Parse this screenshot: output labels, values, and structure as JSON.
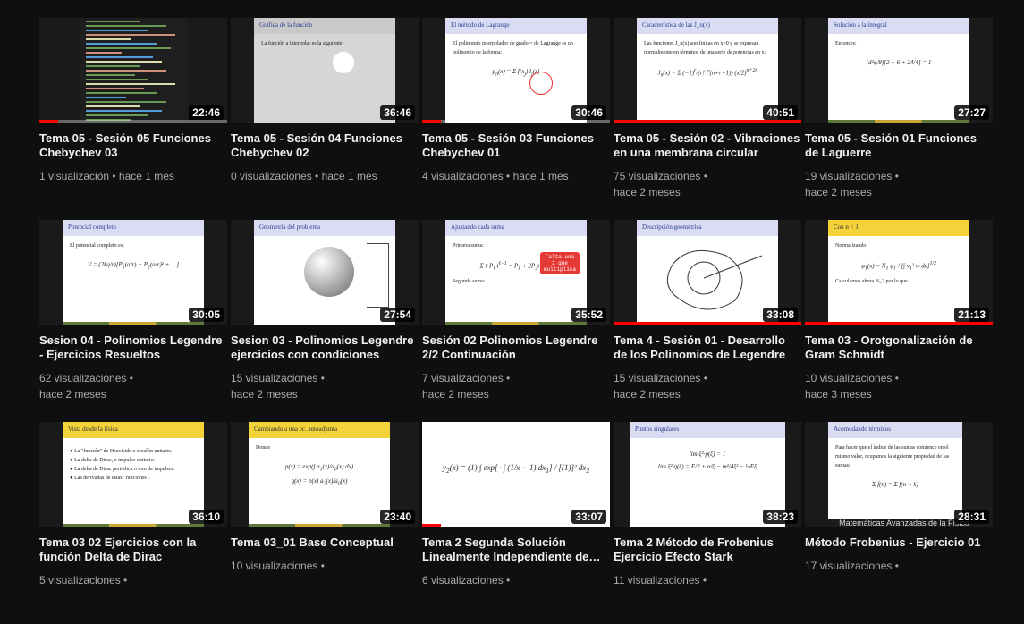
{
  "videos": [
    {
      "title": "Tema 05 - Sesión 05 Funciones Chebychev 03",
      "views": "1 visualización",
      "age": "hace 1 mes",
      "duration": "22:46",
      "progress": 0.1
    },
    {
      "title": "Tema 05 - Sesión 04 Funciones Chebychev 02",
      "views": "0 visualizaciones",
      "age": "hace 1 mes",
      "duration": "36:46",
      "progress": 0.0,
      "slide_header": "Gráfica de la función",
      "slide_text": "La función a interpolar es la siguiente:"
    },
    {
      "title": "Tema 05 - Sesión 03 Funciones Chebychev 01",
      "views": "4 visualizaciones",
      "age": "hace 1 mes",
      "duration": "30:46",
      "progress": 0.1,
      "slide_header": "El método de Lagrange",
      "slide_text": "El polinomio interpolador de grado = de Lagrange es un polinomio de la forma:"
    },
    {
      "title": "Tema 05 - Sesión 02 - Vibraciones en una membrana circular",
      "views": "75 visualizaciones",
      "age": "hace 2 meses",
      "duration": "40:51",
      "progress": 1.0,
      "slide_header": "Característica de las J_n(x)",
      "slide_text": "Las funciones J_n(x) son finitas en x=0 y se expresan normalmente en términos de una serie de potencias en x:"
    },
    {
      "title": "Tema 05 - Sesión 01 Funciones de Laguerre",
      "views": "19 visualizaciones",
      "age": "hace 2 meses",
      "duration": "27:27",
      "progress": 0.0,
      "slide_header": "Solución a la integral",
      "slide_text": "Entonces:"
    },
    {
      "title": "Sesion 04 - Polinomios Legendre - Ejercicios Resueltos",
      "views": "62 visualizaciones",
      "age": "hace 2 meses",
      "duration": "30:05",
      "progress": 0.0,
      "slide_header": "Potencial completo",
      "slide_text": "El potencial completo es:"
    },
    {
      "title": "Sesion 03 - Polinomios Legendre ejercicios con condiciones",
      "views": "15 visualizaciones",
      "age": "hace 2 meses",
      "duration": "27:54",
      "progress": 0.0,
      "slide_header": "Geometría del problema"
    },
    {
      "title": "Sesión 02 Polinomios Legendre 2/2 Continuación",
      "views": "7 visualizaciones",
      "age": "hace 2 meses",
      "duration": "35:52",
      "progress": 0.0,
      "slide_header": "Ajustando cada suma",
      "slide_text": "Primera suma:",
      "slide_text2": "Segunda suma:",
      "balloon": "Falta una 1 que multiplica"
    },
    {
      "title": "Tema 4 - Sesión 01 - Desarrollo de los Polinomios de Legendre",
      "views": "15 visualizaciones",
      "age": "hace 2 meses",
      "duration": "33:08",
      "progress": 1.0,
      "slide_header": "Descripción geométrica"
    },
    {
      "title": "Tema 03 - Orotgonalización de Gram Schmidt",
      "views": "10 visualizaciones",
      "age": "hace 3 meses",
      "duration": "21:13",
      "progress": 1.0,
      "slide_header": "Con n = 1",
      "slide_text": "Normalizando:",
      "slide_text2": "Calculamos ahora N_2 por lo que"
    },
    {
      "title": "Tema 03 02 Ejercicios con la función Delta de Dirac",
      "views": "5 visualizaciones",
      "age": "",
      "duration": "36:10",
      "progress": 0.0,
      "slide_header": "Vista desde la física",
      "bullets": [
        "La \"función\" de Heaviside o escalón unitario.",
        "La delta de Dirac, o impulso unitario.",
        "La delta de Dirac periódica o tren de impulsos.",
        "Las derivadas de estas \"funciones\"."
      ]
    },
    {
      "title": "Tema 03_01 Base Conceptual",
      "views": "10 visualizaciones",
      "age": "",
      "duration": "23:40",
      "progress": 0.0,
      "slide_header": "Cambiando a una ec. autoadjunta",
      "slide_text": "Donde"
    },
    {
      "title": "Tema 2 Segunda Solución Linealmente Independiente de Frobenius",
      "views": "6 visualizaciones",
      "age": "",
      "duration": "33:07",
      "progress": 0.1
    },
    {
      "title": "Tema 2 Método de Frobenius Ejercicio Efecto Stark",
      "views": "11 visualizaciones",
      "age": "",
      "duration": "38:23",
      "progress": 0.0,
      "slide_header": "Puntos singulares"
    },
    {
      "title": "Método Frobenius - Ejercicio 01",
      "views": "17 visualizaciones",
      "age": "",
      "duration": "28:31",
      "progress": 0.0,
      "slide_header": "Acomodando términos",
      "slide_text": "Para hacer que el índice de las sumas comience en el mismo valor, ocupamos la siguiente propiedad de las sumas:",
      "watermark": "Matemáticas Avanzadas de la Física"
    }
  ]
}
